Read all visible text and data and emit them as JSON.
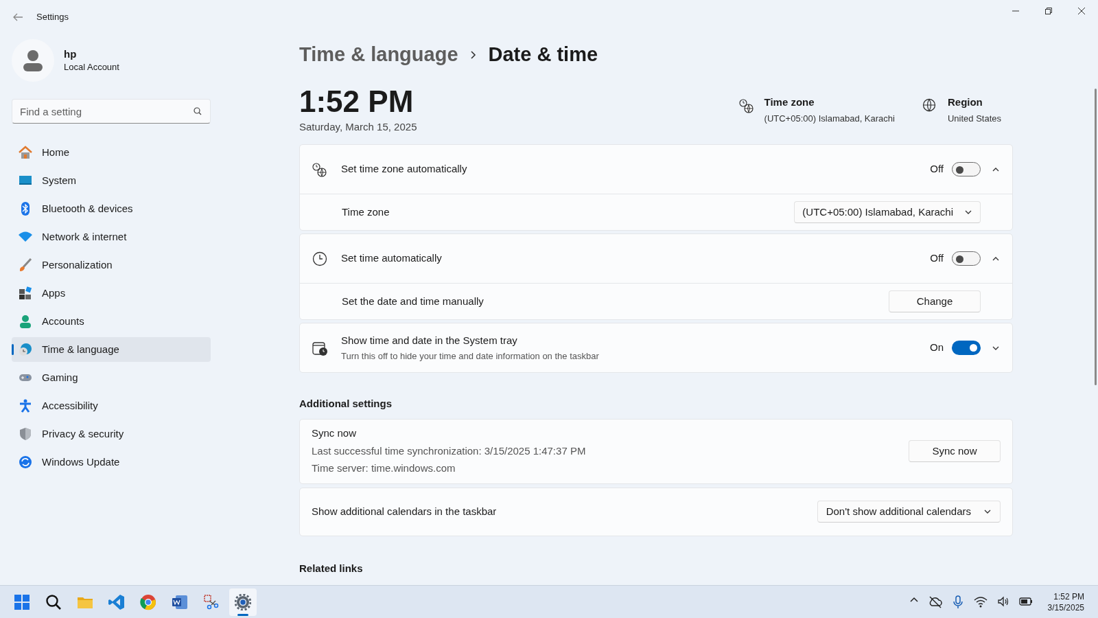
{
  "window": {
    "title": "Settings"
  },
  "user": {
    "name": "hp",
    "account": "Local Account"
  },
  "search": {
    "placeholder": "Find a setting"
  },
  "nav": [
    {
      "label": "Home",
      "selected": false
    },
    {
      "label": "System",
      "selected": false
    },
    {
      "label": "Bluetooth & devices",
      "selected": false
    },
    {
      "label": "Network & internet",
      "selected": false
    },
    {
      "label": "Personalization",
      "selected": false
    },
    {
      "label": "Apps",
      "selected": false
    },
    {
      "label": "Accounts",
      "selected": false
    },
    {
      "label": "Time & language",
      "selected": true
    },
    {
      "label": "Gaming",
      "selected": false
    },
    {
      "label": "Accessibility",
      "selected": false
    },
    {
      "label": "Privacy & security",
      "selected": false
    },
    {
      "label": "Windows Update",
      "selected": false
    }
  ],
  "breadcrumb": [
    "Time & language",
    "Date & time"
  ],
  "clock": {
    "time": "1:52 PM",
    "date": "Saturday, March 15, 2025"
  },
  "summary": [
    {
      "label": "Time zone",
      "value": "(UTC+05:00) Islamabad, Karachi"
    },
    {
      "label": "Region",
      "value": "United States"
    }
  ],
  "cards": [
    {
      "rows": [
        {
          "kind": "toggle",
          "label": "Set time zone automatically",
          "state_label": "Off",
          "on": false,
          "expanded": true
        },
        {
          "kind": "dropdown",
          "label": "Time zone",
          "value": "(UTC+05:00) Islamabad, Karachi"
        }
      ]
    },
    {
      "rows": [
        {
          "kind": "toggle",
          "label": "Set time automatically",
          "state_label": "Off",
          "on": false,
          "expanded": true
        },
        {
          "kind": "button",
          "label": "Set the date and time manually",
          "button": "Change"
        }
      ]
    },
    {
      "rows": [
        {
          "kind": "toggle",
          "label": "Show time and date in the System tray",
          "description": "Turn this off to hide your time and date information on the taskbar",
          "state_label": "On",
          "on": true,
          "expanded": false
        }
      ]
    }
  ],
  "additional_settings": {
    "heading": "Additional settings",
    "cards": [
      {
        "kind": "button",
        "label": "Sync now",
        "lines": [
          "Last successful time synchronization: 3/15/2025 1:47:37 PM",
          "Time server: time.windows.com"
        ],
        "button": "Sync now"
      },
      {
        "kind": "dropdown",
        "label": "Show additional calendars in the taskbar",
        "value": "Don't show additional calendars"
      }
    ]
  },
  "related_links": {
    "heading": "Related links"
  },
  "taskbar": {
    "apps": [
      {
        "selected": false
      },
      {
        "selected": false
      },
      {
        "selected": false
      },
      {
        "selected": false
      },
      {
        "selected": false
      },
      {
        "selected": false
      },
      {
        "selected": false
      },
      {
        "selected": true
      }
    ],
    "time": "1:52 PM",
    "date": "3/15/2025"
  }
}
